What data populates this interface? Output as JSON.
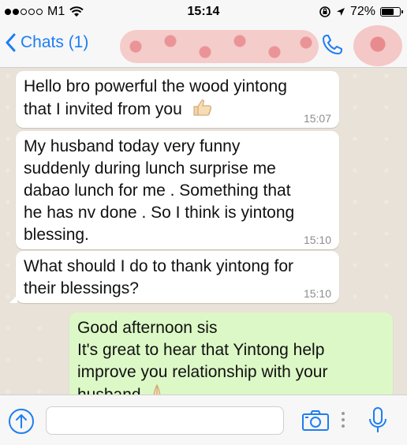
{
  "status_bar": {
    "carrier": "M1",
    "time": "15:14",
    "battery": "72%",
    "battery_level": 0.72
  },
  "nav": {
    "back_label": "Chats (1)",
    "accent_color": "#1e7ef2"
  },
  "messages": [
    {
      "direction": "incoming",
      "text_lines": [
        "Hello bro powerful the wood yintong",
        "that I invited from you"
      ],
      "emoji": "thumbs-up-icon",
      "time": "15:07"
    },
    {
      "direction": "incoming",
      "text_lines": [
        "My husband today very funny",
        "suddenly during lunch surprise me",
        "dabao lunch for me . Something that",
        "he has nv done . So I think is yintong",
        "blessing."
      ],
      "time": "15:10"
    },
    {
      "direction": "incoming",
      "text_lines": [
        "What should I do to thank yintong for",
        "their blessings?"
      ],
      "time": "15:10"
    },
    {
      "direction": "outgoing",
      "text_lines": [
        "Good afternoon sis",
        "It's great to hear that Yintong help",
        "improve you relationship with your",
        "husband"
      ],
      "emoji": "praying-hands-icon"
    }
  ],
  "colors": {
    "incoming_bubble": "#ffffff",
    "outgoing_bubble": "#dcf8c6",
    "chat_background": "#e9e2d8"
  }
}
